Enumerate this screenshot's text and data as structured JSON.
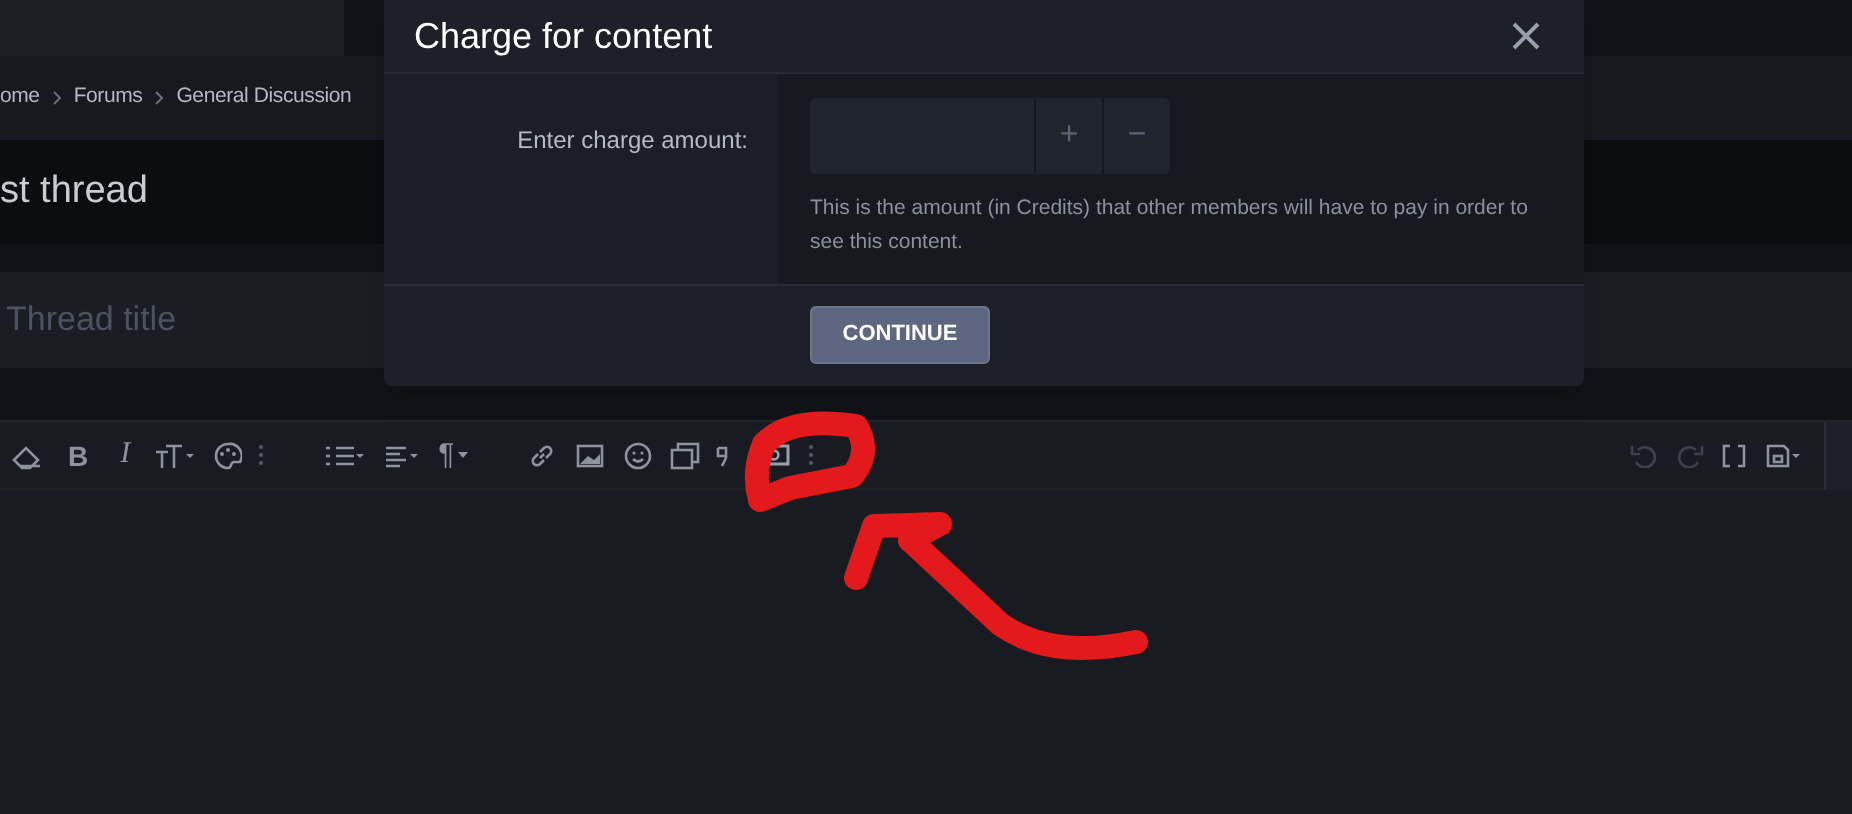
{
  "breadcrumb": [
    "ome",
    "Forums",
    "General Discussion"
  ],
  "page_title": "st thread",
  "title_field": {
    "placeholder": "Thread title"
  },
  "editor_toolbar": {
    "bold": "B",
    "italic": "I",
    "paragraph": "¶"
  },
  "dialog": {
    "title": "Charge for content",
    "label": "Enter charge amount:",
    "amount_field": {
      "plus": "+",
      "minus": "−"
    },
    "hint": "This is the amount (in Credits) that other members will have to pay in order to see this content.",
    "button": "CONTINUE"
  }
}
